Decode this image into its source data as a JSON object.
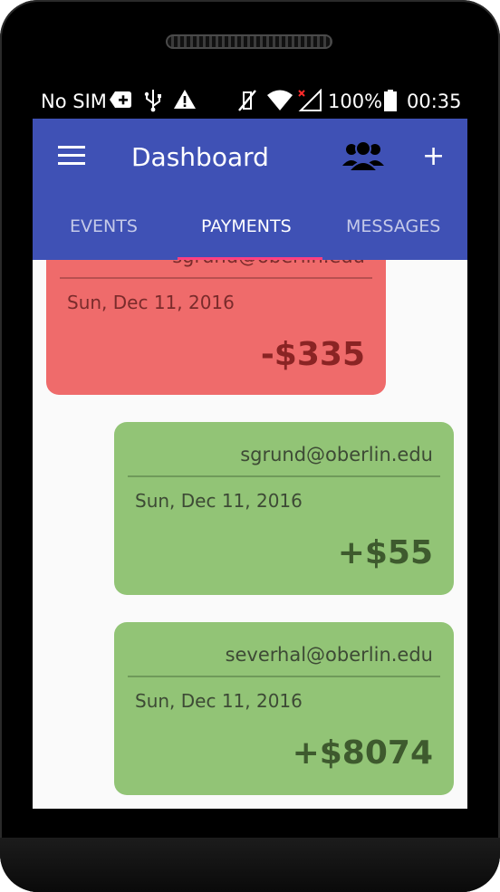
{
  "status_bar": {
    "carrier": "No SIM",
    "battery": "100%",
    "time": "00:35"
  },
  "app_bar": {
    "title": "Dashboard",
    "add_label": "+"
  },
  "tabs": [
    {
      "label": "EVENTS",
      "active": false
    },
    {
      "label": "PAYMENTS",
      "active": true
    },
    {
      "label": "MESSAGES",
      "active": false
    }
  ],
  "payments": [
    {
      "email": "sgrund@oberlin.edu",
      "date": "Sun, Dec 11, 2016",
      "amount": "-$335",
      "type": "negative"
    },
    {
      "email": "sgrund@oberlin.edu",
      "date": "Sun, Dec 11, 2016",
      "amount": "+$55",
      "type": "positive"
    },
    {
      "email": "severhal@oberlin.edu",
      "date": "Sun, Dec 11, 2016",
      "amount": "+$8074",
      "type": "positive"
    }
  ],
  "colors": {
    "primary": "#3f51b5",
    "accent": "#ff4081",
    "negative_card": "#ef6b6b",
    "positive_card": "#92c476"
  }
}
